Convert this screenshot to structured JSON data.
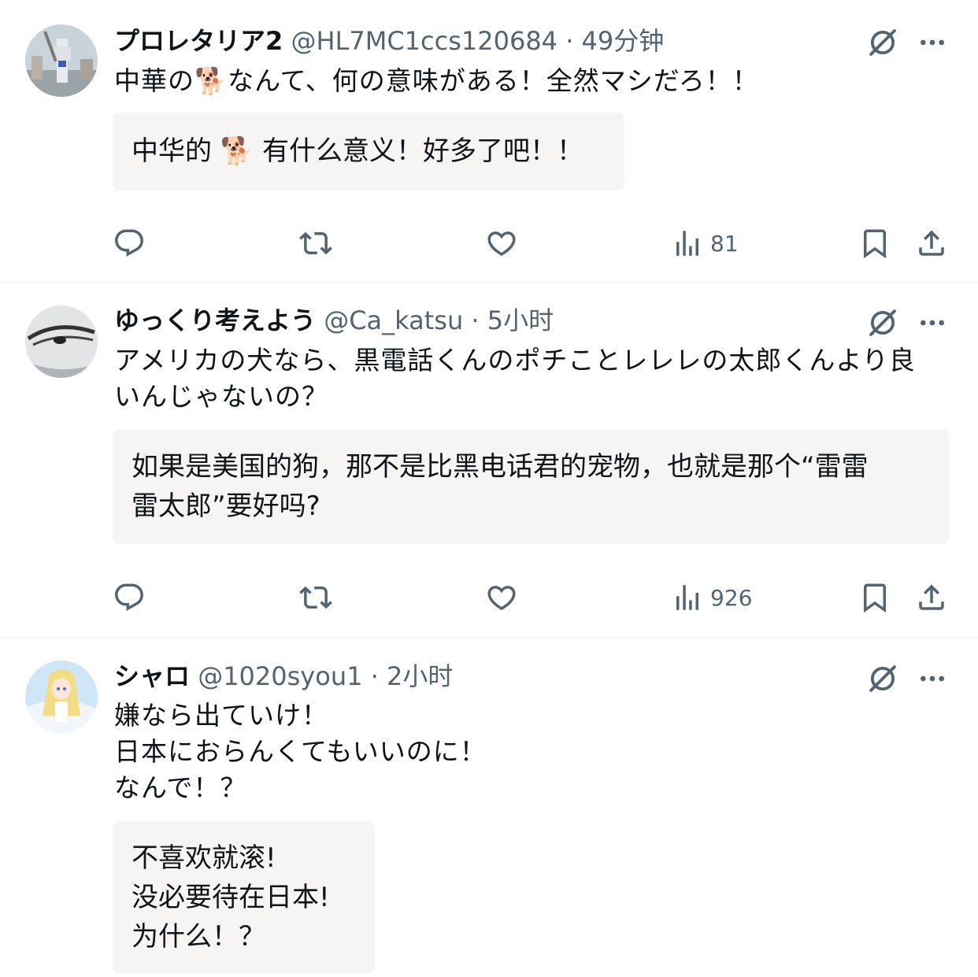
{
  "tweets": [
    {
      "name": "プロレタリア2",
      "handle": "@HL7MC1ccs120684",
      "time": "49分钟",
      "text_lines": [
        "中華の🐕なんて、何の意味がある！全然マシだろ！！"
      ],
      "translation_lines": [
        "中华的 🐕 有什么意义！好多了吧！！"
      ],
      "views": "81"
    },
    {
      "name": "ゆっくり考えよう",
      "handle": "@Ca_katsu",
      "time": "5小时",
      "text_lines": [
        "アメリカの犬なら、黒電話くんのポチことレレレの太郎くんより良",
        "いんじゃないの？"
      ],
      "translation_lines": [
        "如果是美国的狗，那不是比黑电话君的宠物，也就是那个“雷雷",
        "雷太郎”要好吗?"
      ],
      "views": "926"
    },
    {
      "name": "シャロ",
      "handle": "@1020syou1",
      "time": "2小时",
      "text_lines": [
        "嫌なら出ていけ！",
        "日本におらんくてもいいのに！",
        "なんで！？"
      ],
      "translation_lines": [
        "不喜欢就滚!",
        "没必要待在日本!",
        "为什么！？"
      ],
      "views": ""
    }
  ],
  "separator": " · ",
  "icons": {
    "reply": "reply-icon",
    "retweet": "retweet-icon",
    "like": "heart-icon",
    "views": "views-chart-icon",
    "bookmark": "bookmark-icon",
    "share": "share-icon",
    "grok": "grok-icon",
    "more": "more-dots-icon"
  },
  "colors": {
    "text": "#0f1419",
    "secondary": "#536471",
    "translation_bg": "#f7f5f4",
    "divider": "#eff3f4"
  }
}
